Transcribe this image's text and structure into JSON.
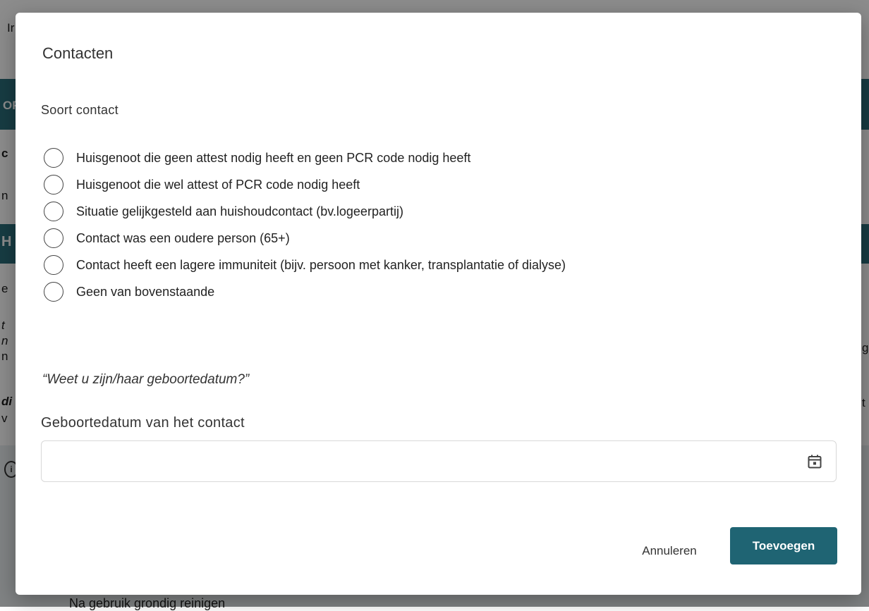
{
  "background": {
    "fragments": [
      "Ir",
      "OF",
      "c",
      "n",
      "H",
      "e",
      "t",
      "n",
      "n",
      "di",
      "v",
      "g",
      "t"
    ],
    "bottom_text": "Na gebruik grondig reinigen",
    "info_icon": "info-icon"
  },
  "modal": {
    "title": "Contacten",
    "section_label": "Soort contact",
    "options": [
      {
        "label": "Huisgenoot die geen attest nodig heeft en geen PCR code nodig heeft",
        "selected": false
      },
      {
        "label": "Huisgenoot die wel attest of PCR code nodig heeft",
        "selected": false
      },
      {
        "label": "Situatie gelijkgesteld aan huishoudcontact (bv.logeerpartij)",
        "selected": false
      },
      {
        "label": "Contact was een oudere person (65+)",
        "selected": false
      },
      {
        "label": "Contact heeft een lagere immuniteit (bijv. persoon met kanker, transplantatie of dialyse)",
        "selected": false
      },
      {
        "label": "Geen van bovenstaande",
        "selected": false
      }
    ],
    "question": "“Weet u zijn/haar geboortedatum?”",
    "date_field": {
      "label": "Geboortedatum van het contact",
      "value": "",
      "placeholder": "",
      "icon": "calendar-icon"
    },
    "buttons": {
      "cancel": "Annuleren",
      "submit": "Toevoegen"
    }
  },
  "colors": {
    "accent": "#1f6473",
    "overlay": "rgba(0,0,0,0.45)",
    "header_band": "#2a6e7a"
  }
}
